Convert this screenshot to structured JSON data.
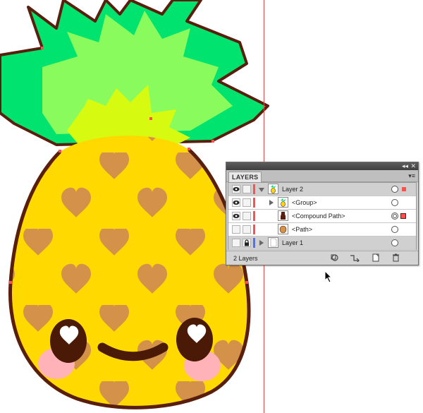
{
  "panel": {
    "collapse_glyph": "◂◂",
    "close_glyph": "✕",
    "tab_label": "LAYERS",
    "menu_glyph": "▾≡",
    "footer_count": "2 Layers",
    "footer_buttons": [
      "make-clipping-mask-icon",
      "create-new-sublayer-icon",
      "create-new-layer-icon",
      "delete-layer-icon"
    ]
  },
  "layers": [
    {
      "name": "Layer 2",
      "indent": 0,
      "expanded": true,
      "visible": true,
      "locked": false,
      "color": "#ff4f4f",
      "selected": true,
      "target": "single",
      "has_selection": true
    },
    {
      "name": "<Group>",
      "indent": 1,
      "expanded": false,
      "visible": true,
      "locked": false,
      "color": "#ff4f4f",
      "selected": false,
      "target": "single",
      "has_selection": false
    },
    {
      "name": "<Compound Path>",
      "indent": 1,
      "expanded": null,
      "visible": true,
      "locked": false,
      "color": "#ff4f4f",
      "selected": false,
      "target": "double",
      "has_selection": true
    },
    {
      "name": "<Path>",
      "indent": 1,
      "expanded": null,
      "visible": false,
      "locked": false,
      "color": "#ff4f4f",
      "selected": false,
      "target": "single",
      "has_selection": false
    },
    {
      "name": "Layer 1",
      "indent": 0,
      "expanded": false,
      "visible": false,
      "locked": true,
      "color": "#4f6fff",
      "selected": true,
      "target": "single",
      "has_selection": false
    }
  ],
  "colors": {
    "outline": "#5a1e0c",
    "leaf_dark": "#00e36e",
    "leaf_mid": "#8afb5d",
    "leaf_light": "#d7fb10",
    "body": "#ffd900",
    "heart": "#d4914a",
    "cheek": "#ffb3b8",
    "eye": "#4a1a07",
    "guide": "#e04848"
  }
}
